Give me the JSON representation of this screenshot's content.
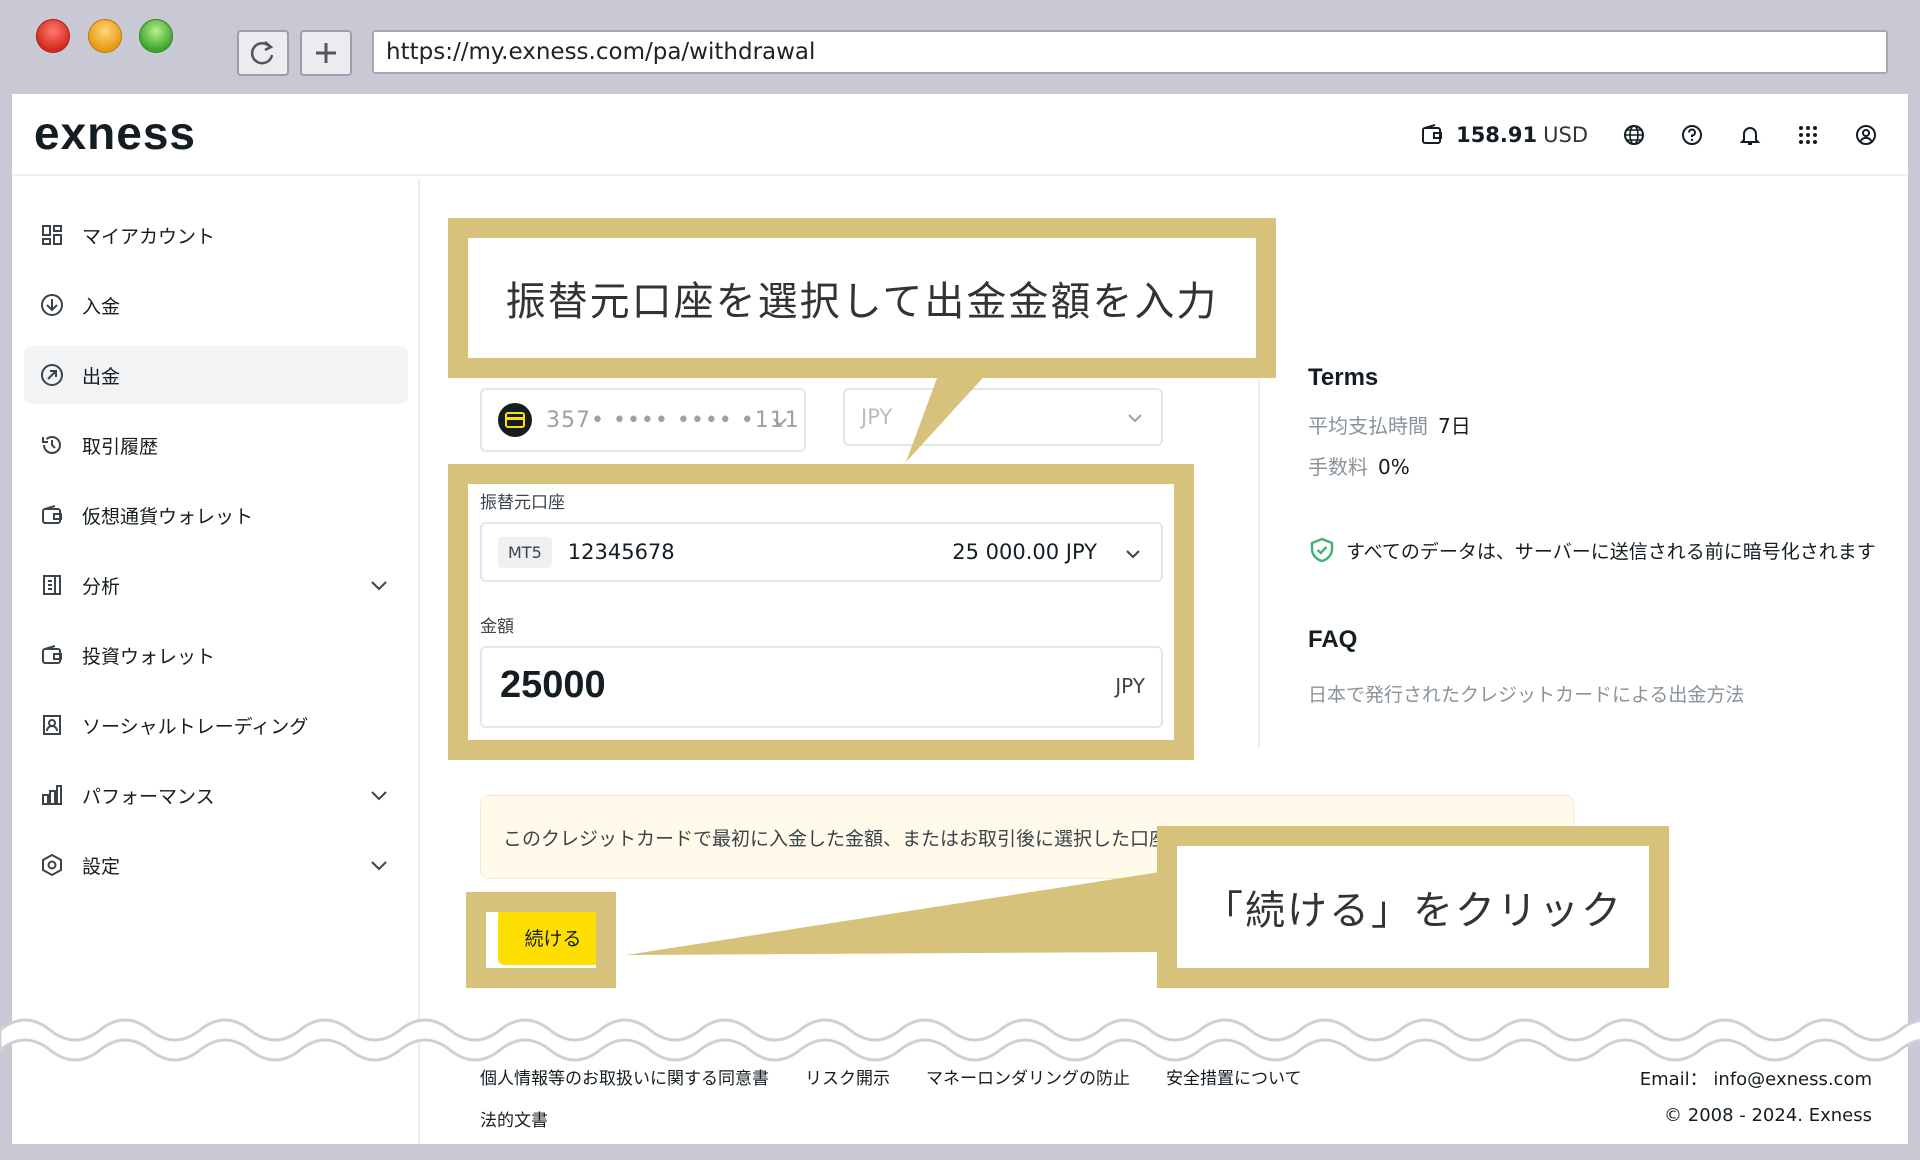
{
  "browser": {
    "url": "https://my.exness.com/pa/withdrawal"
  },
  "header": {
    "logo": "exness",
    "balance_amount": "158.91",
    "balance_currency": "USD"
  },
  "sidebar": {
    "items": [
      {
        "label": "マイアカウント",
        "icon": "dashboard-icon"
      },
      {
        "label": "入金",
        "icon": "deposit-icon"
      },
      {
        "label": "出金",
        "icon": "withdraw-icon",
        "active": true
      },
      {
        "label": "取引履歴",
        "icon": "history-icon"
      },
      {
        "label": "仮想通貨ウォレット",
        "icon": "wallet-icon"
      },
      {
        "label": "分析",
        "icon": "analytics-icon",
        "expandable": true
      },
      {
        "label": "投資ウォレット",
        "icon": "wallet-icon"
      },
      {
        "label": "ソーシャルトレーディング",
        "icon": "social-icon"
      },
      {
        "label": "パフォーマンス",
        "icon": "chart-icon",
        "expandable": true
      },
      {
        "label": "設定",
        "icon": "settings-icon",
        "expandable": true
      }
    ]
  },
  "form": {
    "payment_method": "357• •••• •••• •111",
    "currency": "JPY",
    "source_account_label": "振替元口座",
    "account_type": "MT5",
    "account_number": "12345678",
    "account_balance": "25 000.00 JPY",
    "amount_label": "金額",
    "amount_value": "25000",
    "amount_currency": "JPY",
    "notice": "このクレジットカードで最初に入金した金額、またはお取引後に選択した口座に",
    "continue_label": "続ける"
  },
  "terms": {
    "title": "Terms",
    "processing_label": "平均支払時間",
    "processing_value": "7日",
    "fee_label": "手数料",
    "fee_value": "0%",
    "security_text": "すべてのデータは、サーバーに送信される前に暗号化されます",
    "faq_title": "FAQ",
    "faq_link": "日本で発行されたクレジットカードによる出金方法"
  },
  "footer": {
    "links": [
      "個人情報等のお取扱いに関する同意書",
      "リスク開示",
      "マネーロンダリングの防止",
      "安全措置について"
    ],
    "legal": "法的文書",
    "email_label": "Email：",
    "email": "info@exness.com",
    "copyright": "© 2008 - 2024. Exness"
  },
  "annotations": {
    "callout1": "振替元口座を選択して出金金額を入力",
    "callout2": "「続ける」をクリック"
  },
  "colors": {
    "accent_yellow": "#ffde02",
    "annotation_gold": "#d6c27a",
    "secure_green": "#3cb371"
  }
}
